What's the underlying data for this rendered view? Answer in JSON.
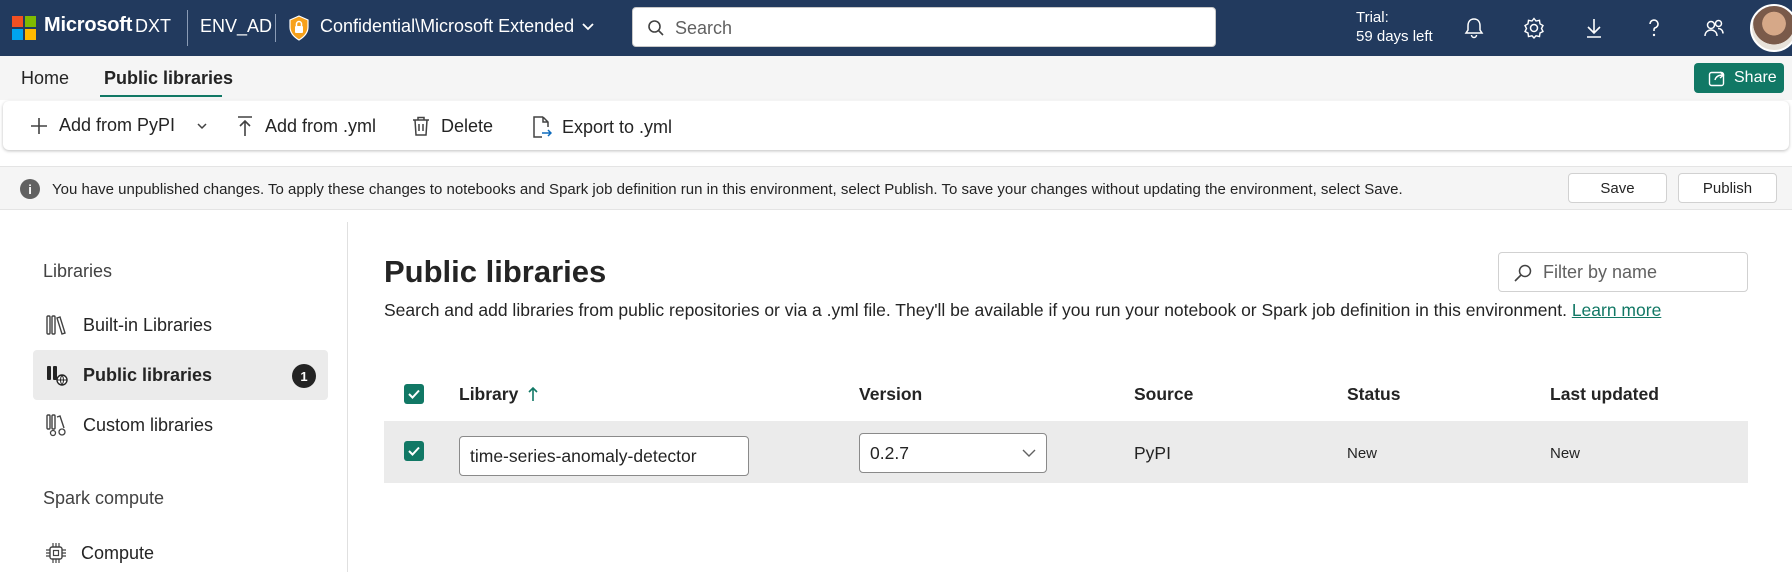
{
  "topbar": {
    "brand": "Microsoft",
    "brand_sub": "DXT",
    "environment": "ENV_AD",
    "sensitivity": "Confidential\\Microsoft Extended",
    "search_placeholder": "Search",
    "trial_line1": "Trial:",
    "trial_line2": "59 days left",
    "icons": [
      "bell-icon",
      "gear-icon",
      "download-icon",
      "help-icon",
      "people-icon"
    ]
  },
  "tabs": [
    {
      "label": "Home"
    },
    {
      "label": "Public libraries"
    }
  ],
  "share_label": "Share",
  "toolbar": {
    "add_pypi": "Add from PyPI",
    "add_yml": "Add from .yml",
    "delete": "Delete",
    "export_yml": "Export to .yml"
  },
  "infobar": {
    "message": "You have unpublished changes. To apply these changes to notebooks and Spark job definition run in this environment, select Publish. To save your changes without updating the environment, select Save.",
    "save": "Save",
    "publish": "Publish"
  },
  "leftnav": {
    "libraries_heading": "Libraries",
    "items": [
      {
        "label": "Built-in Libraries"
      },
      {
        "label": "Public libraries",
        "badge": "1"
      },
      {
        "label": "Custom libraries"
      }
    ],
    "spark_heading": "Spark compute",
    "compute": "Compute"
  },
  "main": {
    "title": "Public libraries",
    "description": "Search and add libraries from public repositories or via a .yml file. They'll be available if you run your notebook or Spark job definition in this environment.",
    "learn_more": "Learn more",
    "filter_placeholder": "Filter by name",
    "columns": {
      "library": "Library",
      "version": "Version",
      "source": "Source",
      "status": "Status",
      "last_updated": "Last updated"
    },
    "rows": [
      {
        "library": "time-series-anomaly-detector",
        "version": "0.2.7",
        "source": "PyPI",
        "status": "New",
        "last_updated": "New"
      }
    ]
  },
  "colors": {
    "topbar": "#223a5e",
    "accent": "#117865"
  }
}
